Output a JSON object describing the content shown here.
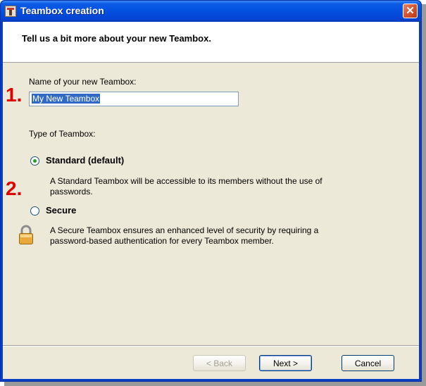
{
  "window": {
    "title": "Teambox creation"
  },
  "header": {
    "text": "Tell us a bit more about your new Teambox."
  },
  "form": {
    "name_label": "Name of your new Teambox:",
    "name_value": "My New Teambox",
    "type_label": "Type of Teambox:",
    "options": [
      {
        "label": "Standard (default)",
        "description_line1": "A Standard Teambox will be accessible to its members without the use of",
        "description_line2": "passwords.",
        "selected": true
      },
      {
        "label": "Secure",
        "description_line1": "A Secure Teambox ensures an enhanced level of security by requiring a",
        "description_line2": "password-based authentication for every Teambox member.",
        "selected": false
      }
    ]
  },
  "markers": {
    "one": "1.",
    "two": "2."
  },
  "buttons": {
    "back": "< Back",
    "next": "Next >",
    "cancel": "Cancel"
  },
  "colors": {
    "titlebar": "#0450e0",
    "client_bg": "#ece9d8",
    "marker_red": "#e00000",
    "radio_dot": "#21a121"
  },
  "icons": {
    "close": "close-icon",
    "app": "teambox-app-icon",
    "lock": "padlock-icon"
  }
}
